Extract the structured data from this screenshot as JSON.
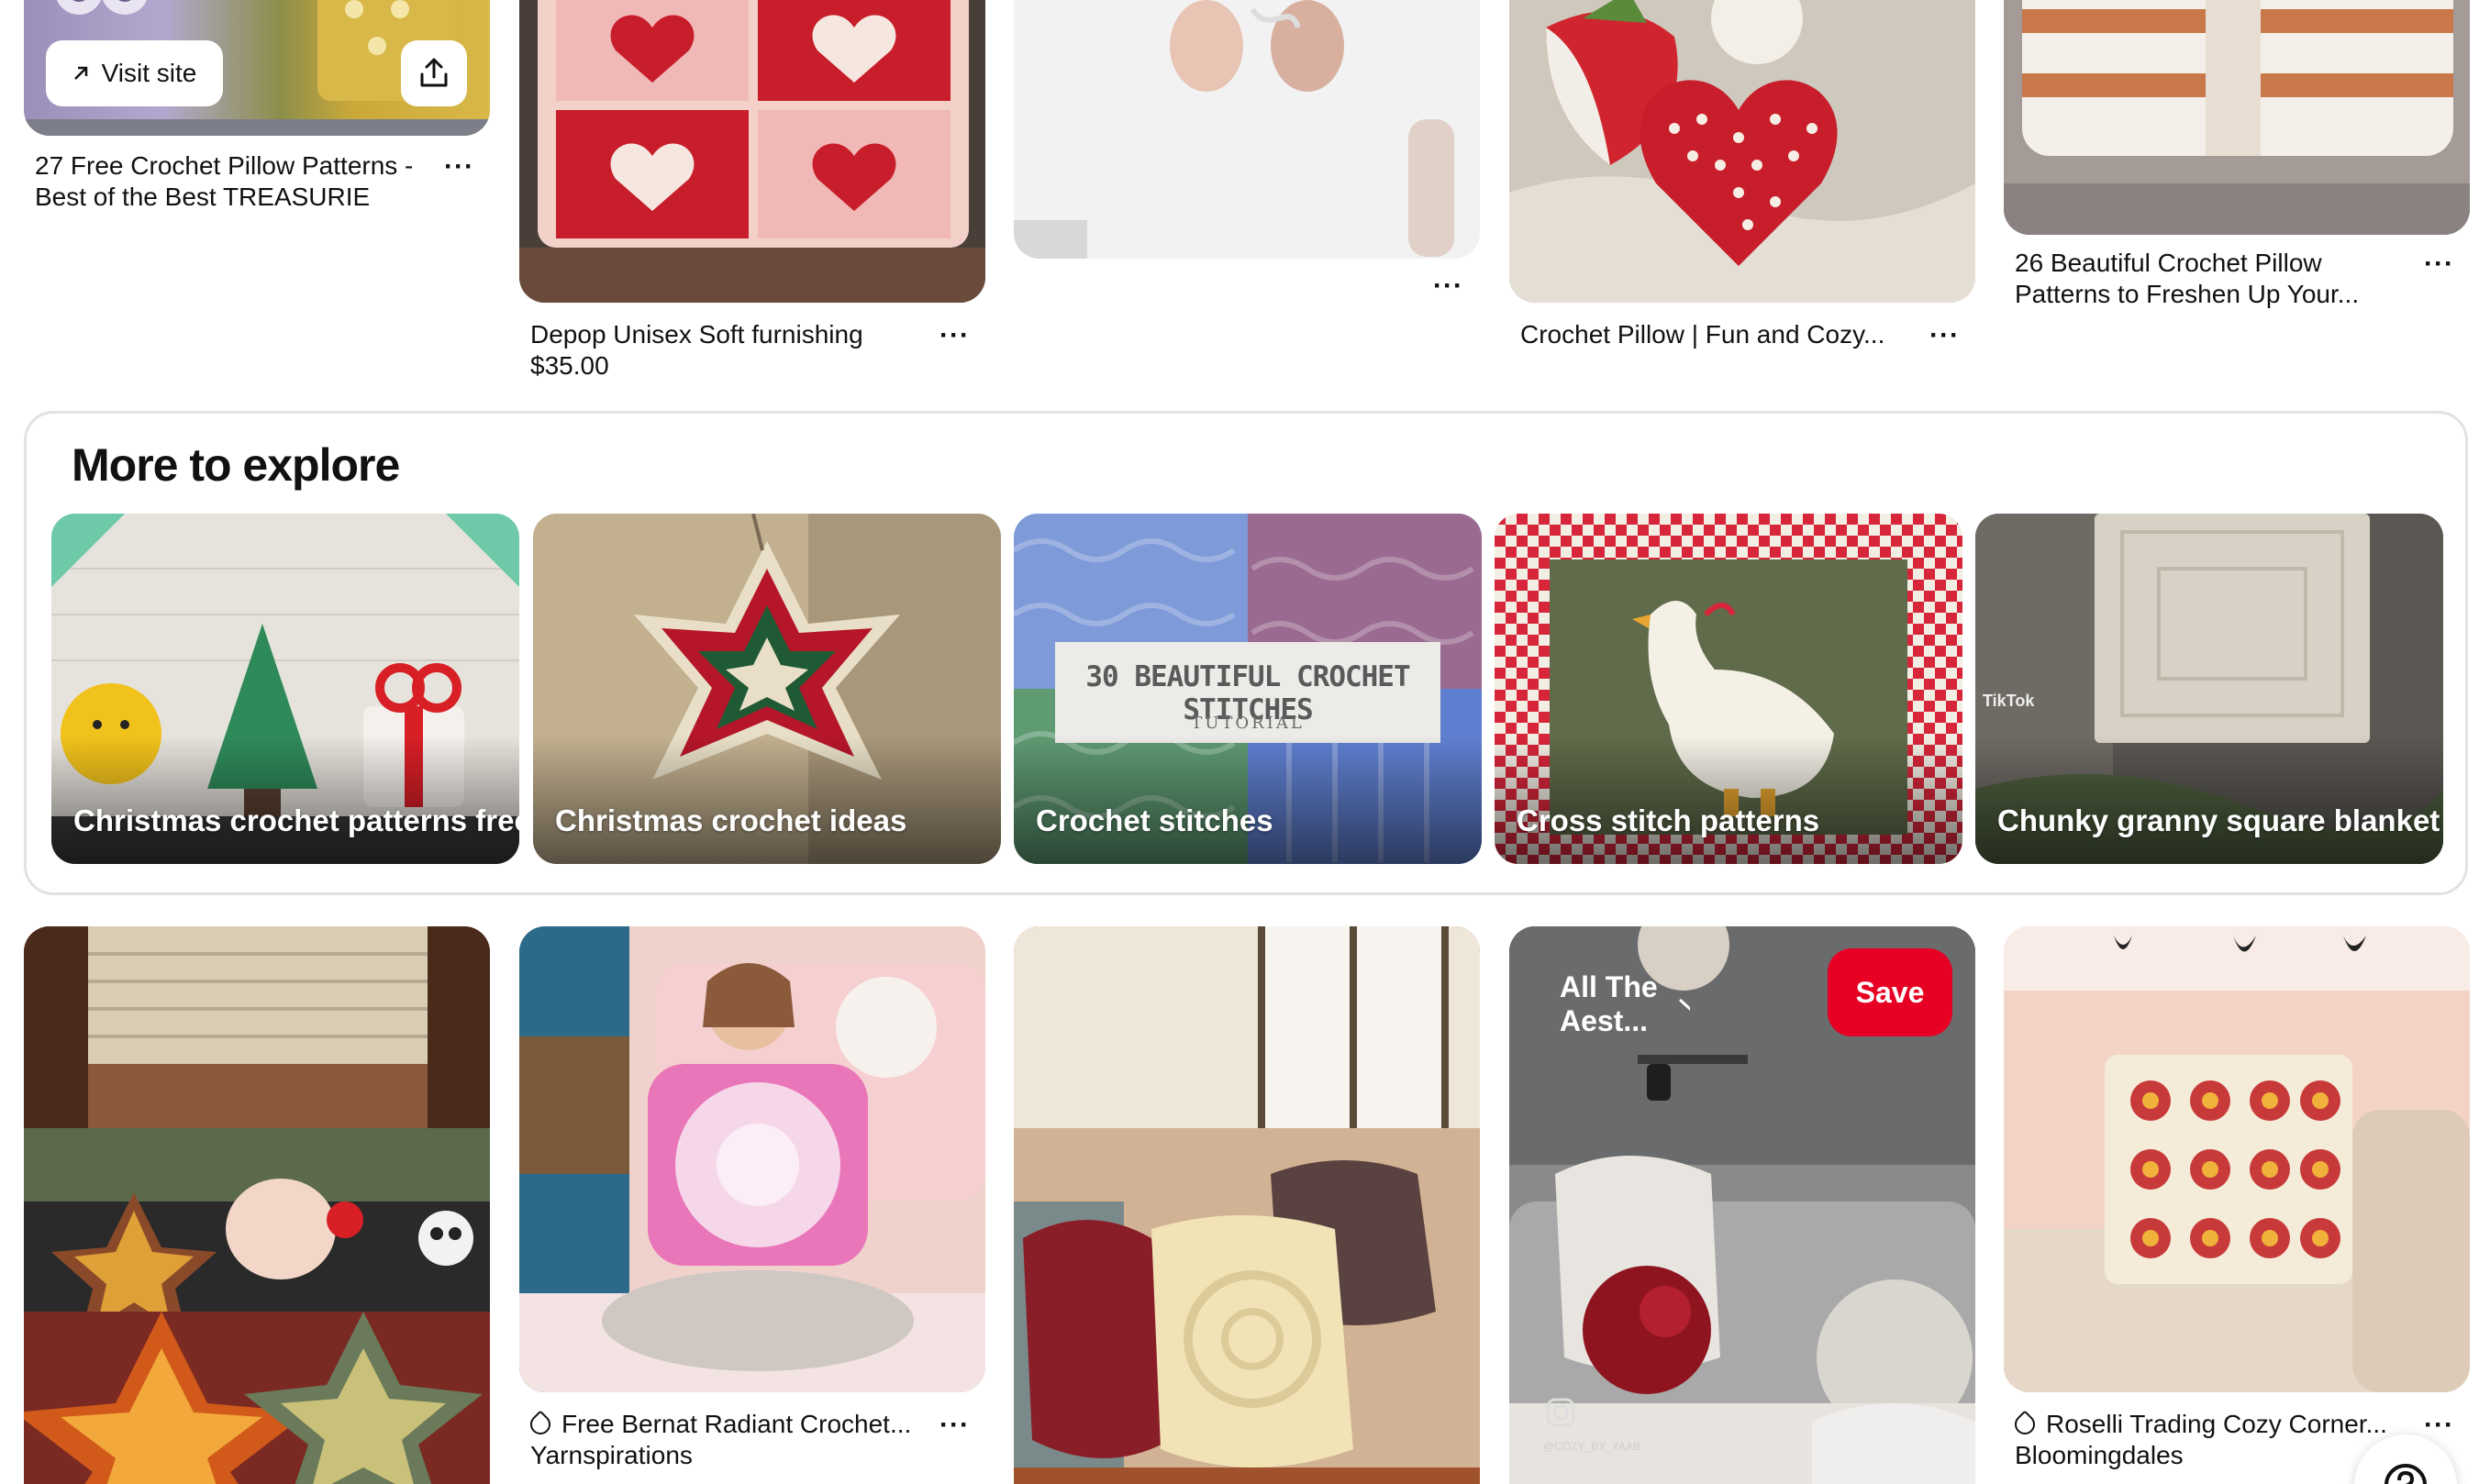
{
  "top_pins": [
    {
      "title": "27 Free Crochet Pillow Patterns - Best of the Best TREASURIE",
      "visit_label": "Visit site"
    },
    {
      "title": "Depop Unisex Soft furnishing",
      "price": "$35.00"
    },
    {
      "title": ""
    },
    {
      "title": "Crochet Pillow | Fun and Cozy..."
    },
    {
      "title": "26 Beautiful Crochet Pillow Patterns to Freshen Up Your..."
    }
  ],
  "more_to_explore": {
    "title": "More to explore",
    "cards": [
      {
        "label": "Christmas crochet patterns free"
      },
      {
        "label": "Christmas crochet ideas"
      },
      {
        "label": "Crochet stitches",
        "overlay_title": "30 BEAUTIFUL CROCHET STITCHES",
        "overlay_subtitle": "TUTORIAL"
      },
      {
        "label": "Cross stitch patterns"
      },
      {
        "label": "Chunky granny square blanket",
        "watermark": "TikTok"
      }
    ]
  },
  "bottom_pins": [
    {
      "title": ""
    },
    {
      "title": "Free Bernat Radiant Crochet...",
      "source": "Yarnspirations"
    },
    {
      "title": ""
    },
    {
      "board": "All The Aest...",
      "save_label": "Save",
      "watermark": "@COZY_BY_YAAB"
    },
    {
      "title": "Roselli Trading Cozy Corner...",
      "source": "Bloomingdales"
    }
  ],
  "more_icon": "more-dots-icon",
  "colors": {
    "save": "#e60023",
    "border": "#e2e2e2"
  }
}
